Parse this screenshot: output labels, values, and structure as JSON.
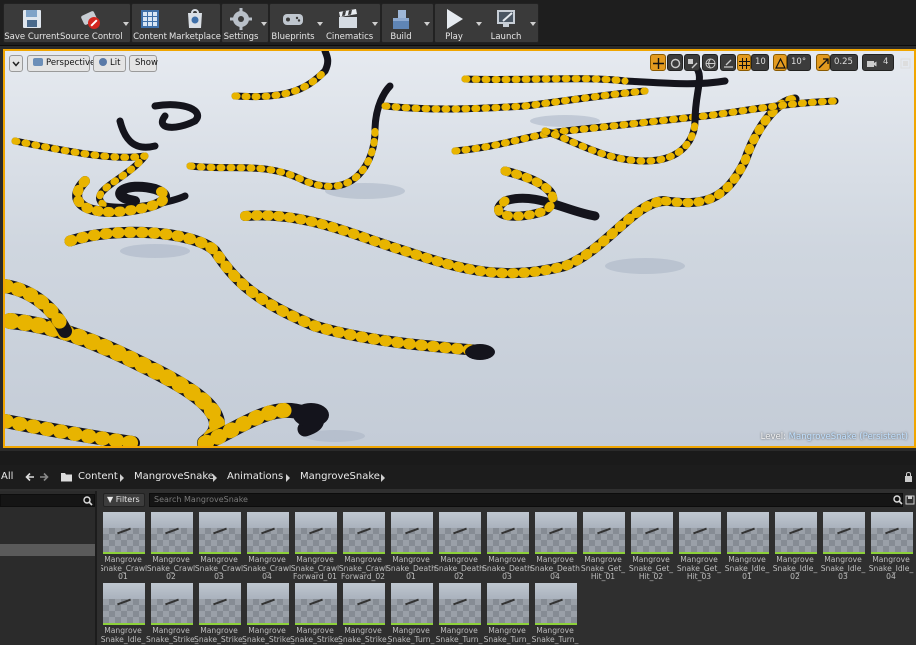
{
  "toolbar": {
    "buttons": [
      {
        "label": "Save Current",
        "icon": "save-icon"
      },
      {
        "label": "Source Control",
        "icon": "source-control-icon"
      },
      {
        "label": "Content",
        "icon": "content-icon"
      },
      {
        "label": "Marketplace",
        "icon": "marketplace-icon"
      },
      {
        "label": "Settings",
        "icon": "settings-icon"
      },
      {
        "label": "Blueprints",
        "icon": "blueprints-icon"
      },
      {
        "label": "Cinematics",
        "icon": "cinematics-icon"
      },
      {
        "label": "Build",
        "icon": "build-icon"
      },
      {
        "label": "Play",
        "icon": "play-icon"
      },
      {
        "label": "Launch",
        "icon": "launch-icon"
      }
    ]
  },
  "viewport": {
    "view_mode": "Perspective",
    "lighting": "Lit",
    "show": "Show",
    "grid_snap": "10",
    "rotation_snap": "10°",
    "scale_snap": "0.25",
    "camera_speed": "4",
    "level_prefix": "Level:",
    "level_name": "MangroveSnake (Persistent)"
  },
  "content_browser": {
    "all_label": "All",
    "breadcrumb": [
      "Content",
      "MangroveSnake",
      "Animations",
      "MangroveSnake"
    ],
    "filters_label": "Filters",
    "search_placeholder": "Search MangroveSnake",
    "assets": [
      [
        "Mangrove",
        "Snake_Crawl",
        "01"
      ],
      [
        "Mangrove",
        "Snake_Crawl",
        "02"
      ],
      [
        "Mangrove",
        "Snake_Crawl",
        "03"
      ],
      [
        "Mangrove",
        "Snake_Crawl",
        "04"
      ],
      [
        "Mangrove",
        "Snake_Crawl",
        "Forward_01"
      ],
      [
        "Mangrove",
        "Snake_Crawl",
        "Forward_02"
      ],
      [
        "Mangrove",
        "Snake_Death",
        "01"
      ],
      [
        "Mangrove",
        "Snake_Death",
        "02"
      ],
      [
        "Mangrove",
        "Snake_Death",
        "03"
      ],
      [
        "Mangrove",
        "Snake_Death",
        "04"
      ],
      [
        "Mangrove",
        "Snake_Get_",
        "Hit_01"
      ],
      [
        "Mangrove",
        "Snake_Get_",
        "Hit_02"
      ],
      [
        "Mangrove",
        "Snake_Get_",
        "Hit_03"
      ],
      [
        "Mangrove",
        "Snake_Idle_",
        "01"
      ],
      [
        "Mangrove",
        "Snake_Idle_",
        "02"
      ],
      [
        "Mangrove",
        "Snake_Idle_",
        "03"
      ],
      [
        "Mangrove",
        "Snake_Idle_",
        "04"
      ],
      [
        "Mangrove",
        "Snake_Idle_",
        ""
      ],
      [
        "Mangrove",
        "Snake_Strike_",
        ""
      ],
      [
        "Mangrove",
        "Snake_Strike_",
        ""
      ],
      [
        "Mangrove",
        "Snake_Strike_",
        ""
      ],
      [
        "Mangrove",
        "Snake_Strike_",
        ""
      ],
      [
        "Mangrove",
        "Snake_Strike_",
        ""
      ],
      [
        "Mangrove",
        "Snake_Turn_",
        ""
      ],
      [
        "Mangrove",
        "Snake_Turn_",
        ""
      ],
      [
        "Mangrove",
        "Snake_Turn_",
        ""
      ],
      [
        "Mangrove",
        "Snake_Turn_",
        ""
      ]
    ]
  },
  "colors": {
    "viewport_border": "#f0a500",
    "snake_body": "#14141c",
    "snake_band": "#e8b400",
    "floor": "#c9d0da"
  }
}
